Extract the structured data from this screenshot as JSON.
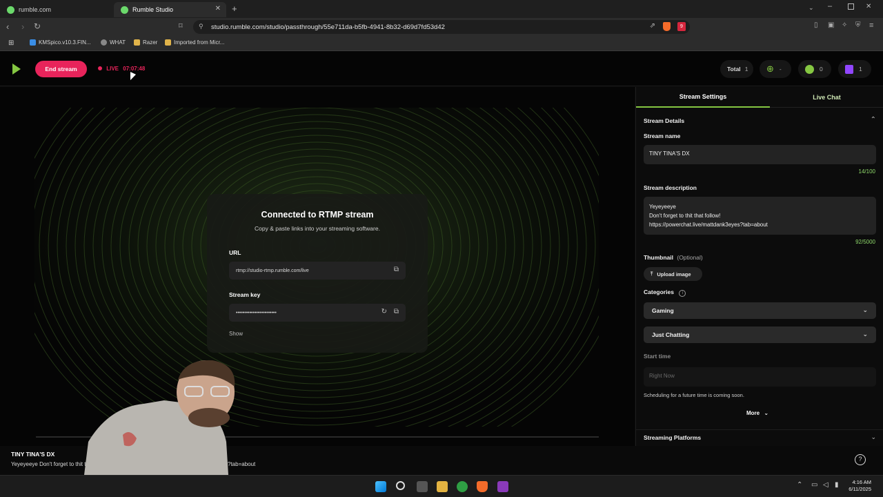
{
  "browser": {
    "tabs": [
      {
        "label": "rumble.com"
      },
      {
        "label": "Rumble Studio"
      }
    ],
    "new_tab": "+",
    "url": "studio.rumble.com/studio/passthrough/55e711da-b5fb-4941-8b32-d69d7fd53d42",
    "bookmarks": [
      "KMSpico.v10.3.FIN...",
      "WHAT",
      "Razer",
      "Imported from Micr..."
    ],
    "notification_count": "9"
  },
  "header": {
    "end_stream_label": "End stream",
    "live_label": "LIVE",
    "live_time": "07:07:48",
    "total_label": "Total",
    "total_count": "1",
    "web_count": "-",
    "rumble_count": "0",
    "twitch_count": "1"
  },
  "rtmp": {
    "title": "Connected to RTMP stream",
    "subtitle": "Copy & paste links into your streaming software.",
    "url_label": "URL",
    "url_value": "rtmp://studio-rtmp.rumble.com/live",
    "key_label": "Stream key",
    "key_value": "••••••••••••••••••••••••",
    "show_label": "Show"
  },
  "panel": {
    "tabs": [
      "Stream Settings",
      "Live Chat"
    ],
    "details_heading": "Stream Details",
    "name_label": "Stream name",
    "name_value": "TINY TINA'S DX",
    "name_counter": "14/100",
    "desc_label": "Stream description",
    "desc_lines": [
      "Yeyeyeeye",
      "Don't forget to thit that follow!",
      "https://powerchat.live/mattdank3eyes?tab=about"
    ],
    "desc_counter": "92/5000",
    "thumb_label": "Thumbnail",
    "thumb_optional": "(Optional)",
    "upload_label": "Upload image",
    "categories_label": "Categories",
    "category_1": "Gaming",
    "category_2": "Just Chatting",
    "start_label": "Start time",
    "start_placeholder": "Right Now",
    "schedule_note": "Scheduling for a future time is coming soon.",
    "more_label": "More",
    "platforms_label": "Streaming Platforms"
  },
  "caption": {
    "title": "TINY TINA'S DX",
    "line_left": "Yeyeyeeye Don't forget to thit tha",
    "line_right": "?tab=about"
  },
  "taskbar": {
    "time": "4:16 AM",
    "date": "6/11/2025"
  },
  "colors": {
    "accent_green": "#85c742",
    "live_red": "#e8245b",
    "twitch_purple": "#9146ff"
  }
}
